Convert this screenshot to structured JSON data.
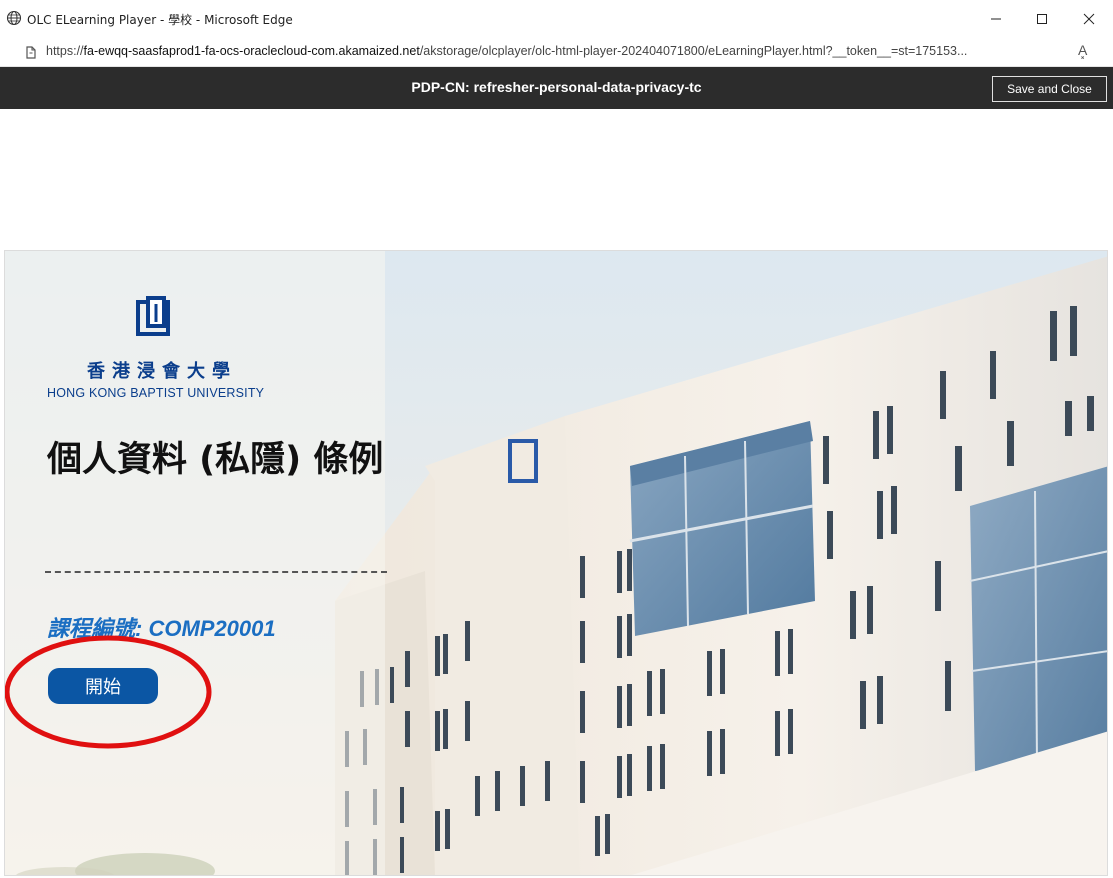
{
  "window": {
    "title": "OLC ELearning Player - 學校 - Microsoft Edge",
    "minimize_icon": "minimize-icon",
    "maximize_icon": "maximize-icon",
    "close_icon": "close-icon"
  },
  "address_bar": {
    "url_prefix": "https://",
    "url_domain": "fa-ewqq-saasfaprod1-fa-ocs-oraclecloud-com.akamaized.net",
    "url_path": "/akstorage/olcplayer/olc-html-player-202404071800/eLearningPlayer.html?__token__=st=175153...",
    "read_aloud_label": "A͓"
  },
  "player": {
    "course_title": "PDP-CN: refresher-personal-data-privacy-tc",
    "save_close_label": "Save and Close"
  },
  "slide": {
    "university_zh": "香港浸會大學",
    "university_en": "HONG KONG BAPTIST UNIVERSITY",
    "title": "個人資料 (私隱) 條例",
    "course_code": "課程編號: COMP20001",
    "start_label": "開始"
  },
  "colors": {
    "brand_blue": "#0b3e8c",
    "button_blue": "#0b56a4",
    "course_code_blue": "#1b6ec2",
    "header_dark": "#2c2c2c",
    "highlight_red": "#e01010"
  }
}
